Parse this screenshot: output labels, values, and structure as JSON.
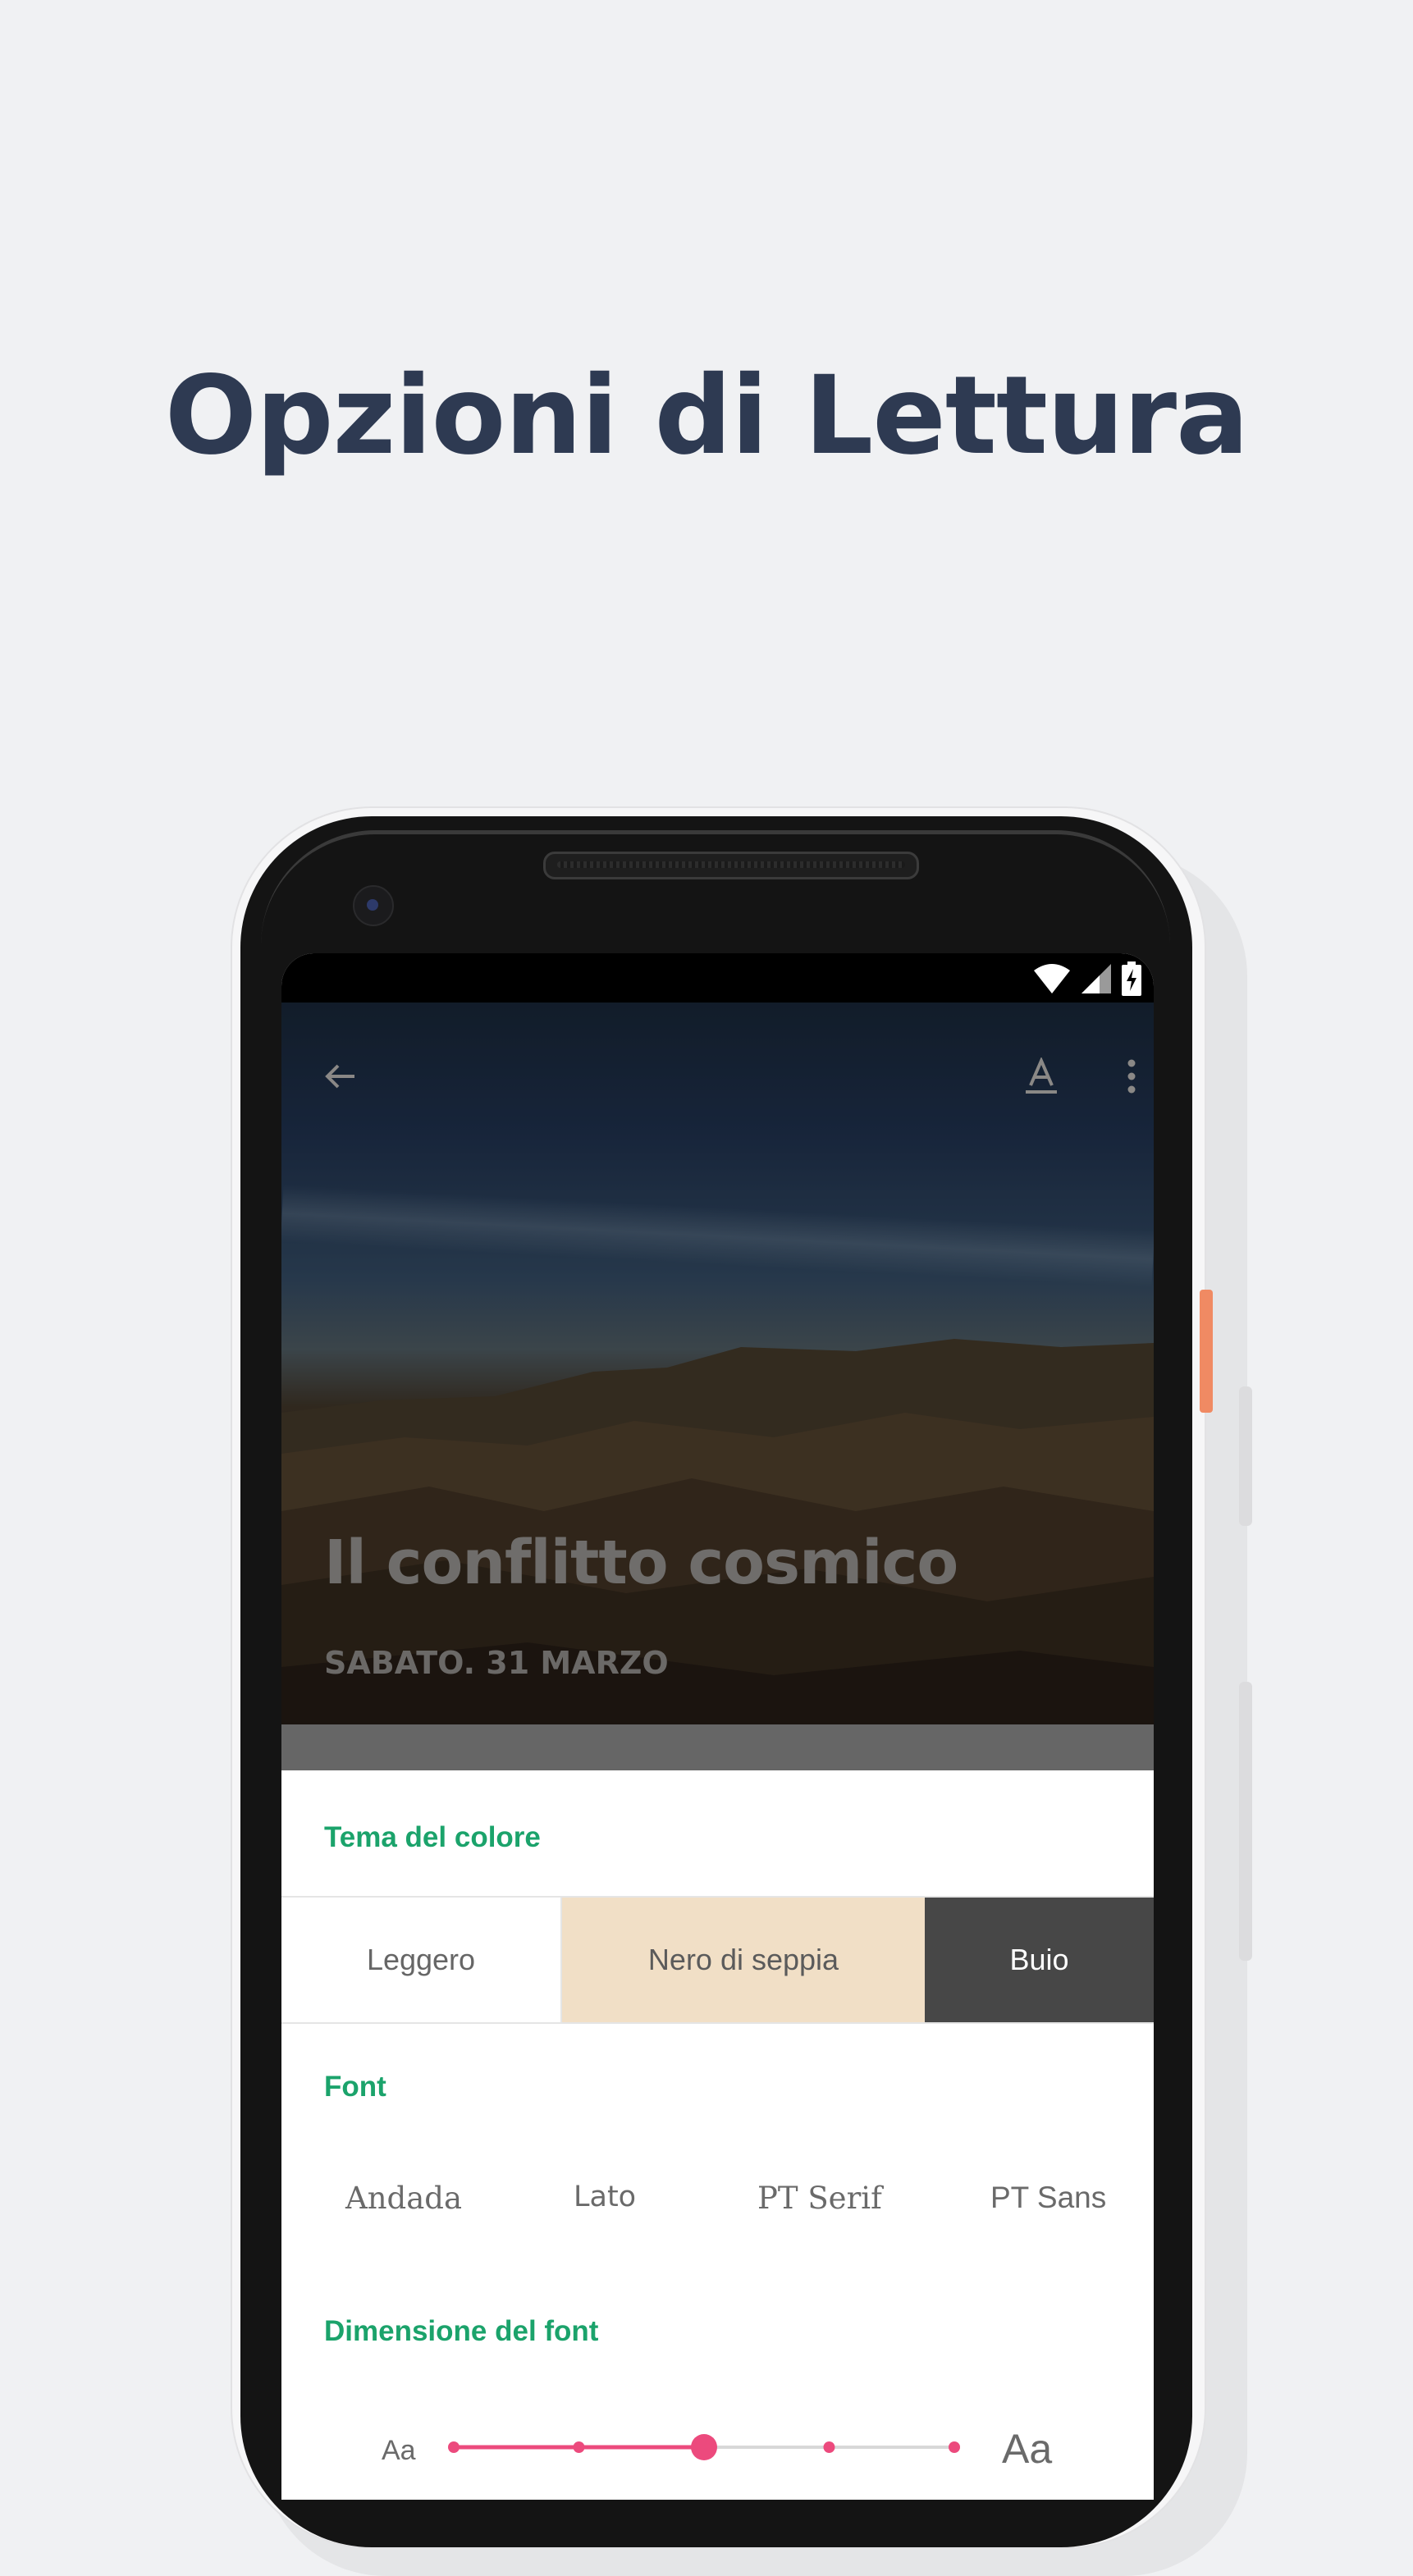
{
  "headline": "Opzioni di Lettura",
  "article": {
    "title": "Il conflitto cosmico",
    "date": "SABATO. 31 MARZO"
  },
  "toolbar": {
    "back_icon": "arrow-back-icon",
    "text_format_icon": "text-format-icon",
    "more_icon": "more-vert-icon"
  },
  "status_bar": {
    "icons": [
      "wifi-icon",
      "signal-icon",
      "battery-charging-icon"
    ]
  },
  "reading_options": {
    "color_theme": {
      "label": "Tema del colore",
      "options": [
        "Leggero",
        "Nero di seppia",
        "Buio"
      ],
      "selected": "Buio"
    },
    "font": {
      "label": "Font",
      "options": [
        "Andada",
        "Lato",
        "PT Serif",
        "PT Sans"
      ]
    },
    "font_size": {
      "label": "Dimensione del font",
      "small_label": "Aa",
      "large_label": "Aa",
      "steps": 5,
      "selected_step": 3
    }
  },
  "colors": {
    "accent_green": "#1ba36b",
    "slider_pink": "#ec4a7d",
    "headline_navy": "#2e3a52",
    "sepia": "#f1dfc6",
    "dark_theme": "#474747"
  }
}
